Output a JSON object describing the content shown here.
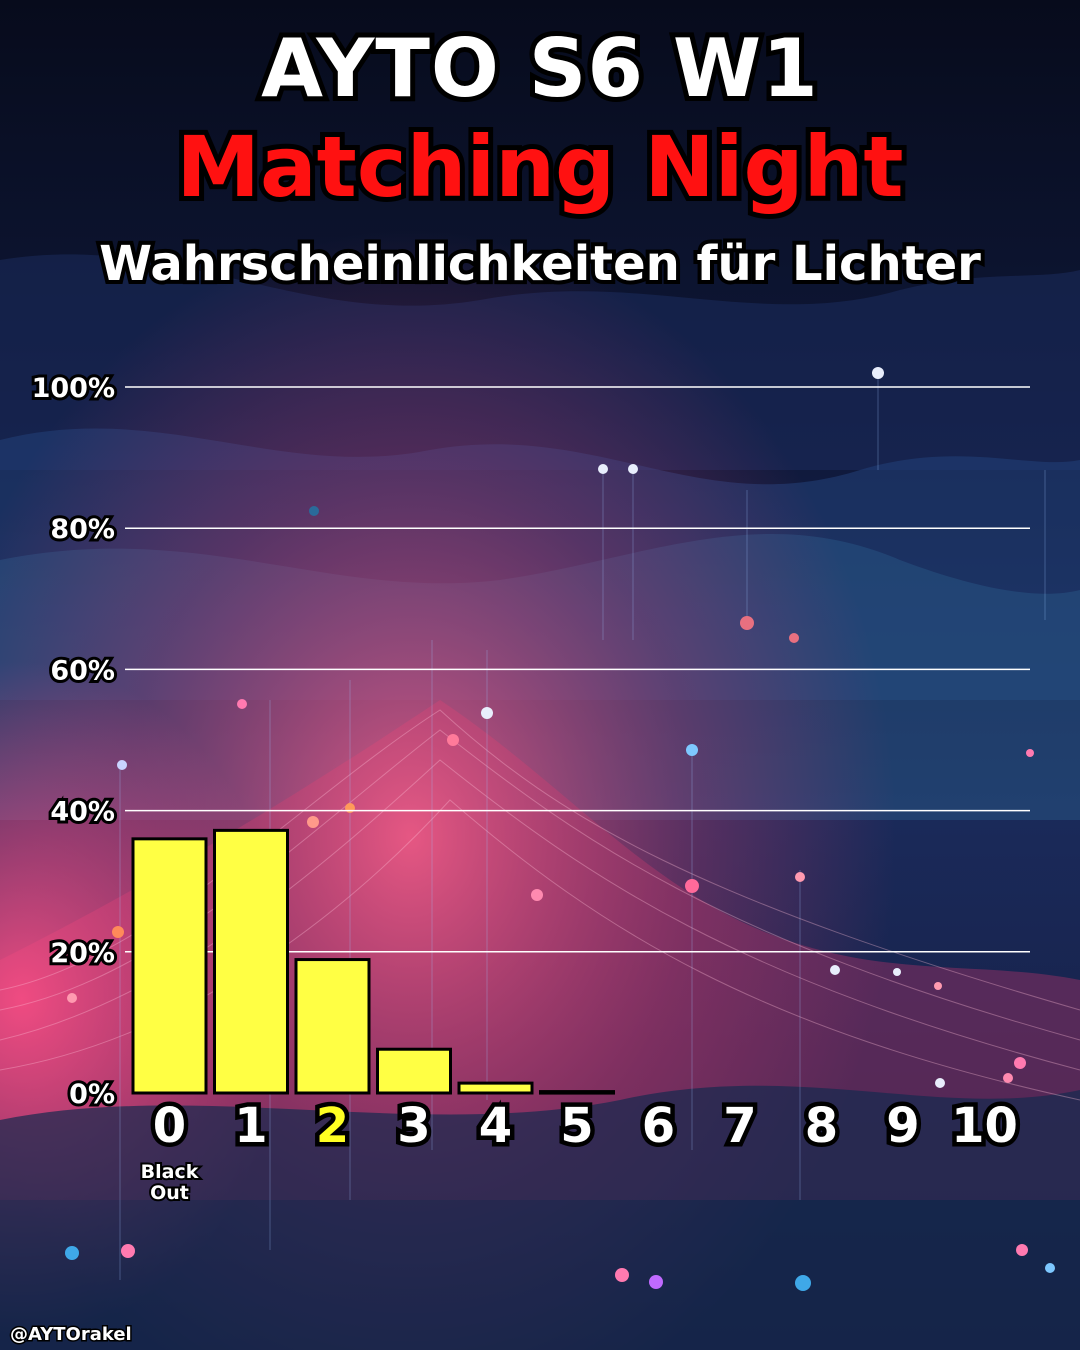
{
  "header": {
    "title": "AYTO S6  W1",
    "subtitle": "Matching Night",
    "caption": "Wahrscheinlichkeiten für Lichter"
  },
  "footer": {
    "handle": "@AYTOrakel"
  },
  "colors": {
    "bar_fill": "#ffff44",
    "bar_stroke": "#000000",
    "highlight_label": "#ffff22",
    "subtitle": "#ff1111",
    "grid": "#ffffff",
    "background": "#0b1124"
  },
  "chart_data": {
    "type": "bar",
    "categories": [
      "0",
      "1",
      "2",
      "3",
      "4",
      "5",
      "6",
      "7",
      "8",
      "9",
      "10"
    ],
    "category_notes": {
      "0": "Black Out"
    },
    "highlighted_category": "2",
    "values": [
      36.0,
      37.2,
      18.9,
      6.2,
      1.4,
      0.2,
      0,
      0,
      0,
      0,
      0
    ],
    "ylim": [
      0,
      100
    ],
    "y_ticks": [
      0,
      20,
      40,
      60,
      80,
      100
    ],
    "y_tick_labels": [
      "0%",
      "20%",
      "40%",
      "60%",
      "80%",
      "100%"
    ],
    "grid": true,
    "legend": "none",
    "title": "Wahrscheinlichkeiten für Lichter",
    "xlabel": "",
    "ylabel": ""
  }
}
